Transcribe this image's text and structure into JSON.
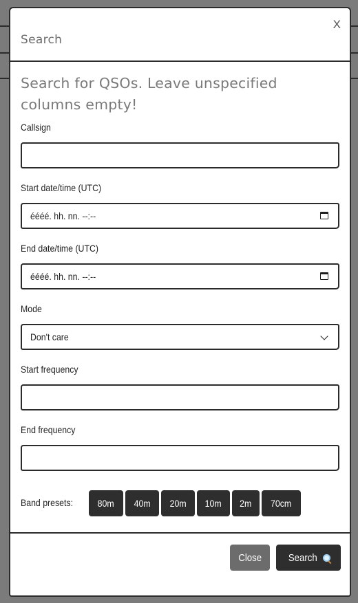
{
  "dialog": {
    "title": "Search",
    "close_glyph": "X",
    "lead": "Search for QSOs. Leave unspecified columns empty!"
  },
  "fields": {
    "callsign": {
      "label": "Callsign",
      "value": ""
    },
    "start_datetime": {
      "label": "Start date/time (UTC)",
      "value": "éééé. hh. nn. --:--"
    },
    "end_datetime": {
      "label": "End date/time (UTC)",
      "value": "éééé. hh. nn. --:--"
    },
    "mode": {
      "label": "Mode",
      "value": "Don't care"
    },
    "start_frequency": {
      "label": "Start frequency",
      "value": ""
    },
    "end_frequency": {
      "label": "End frequency",
      "value": ""
    }
  },
  "band_presets": {
    "label": "Band presets:",
    "items": [
      "80m",
      "40m",
      "20m",
      "10m",
      "2m",
      "70cm"
    ]
  },
  "footer": {
    "close_label": "Close",
    "search_label": "Search"
  },
  "icons": {
    "close": "close-icon",
    "calendar": "calendar-icon",
    "chevron": "chevron-down-icon",
    "search": "magnifier-icon"
  },
  "colors": {
    "primary_button": "#2e2e2e",
    "secondary_button": "#6c6c6c",
    "border": "#2b2b2b",
    "backdrop": "#7b7b7b"
  }
}
